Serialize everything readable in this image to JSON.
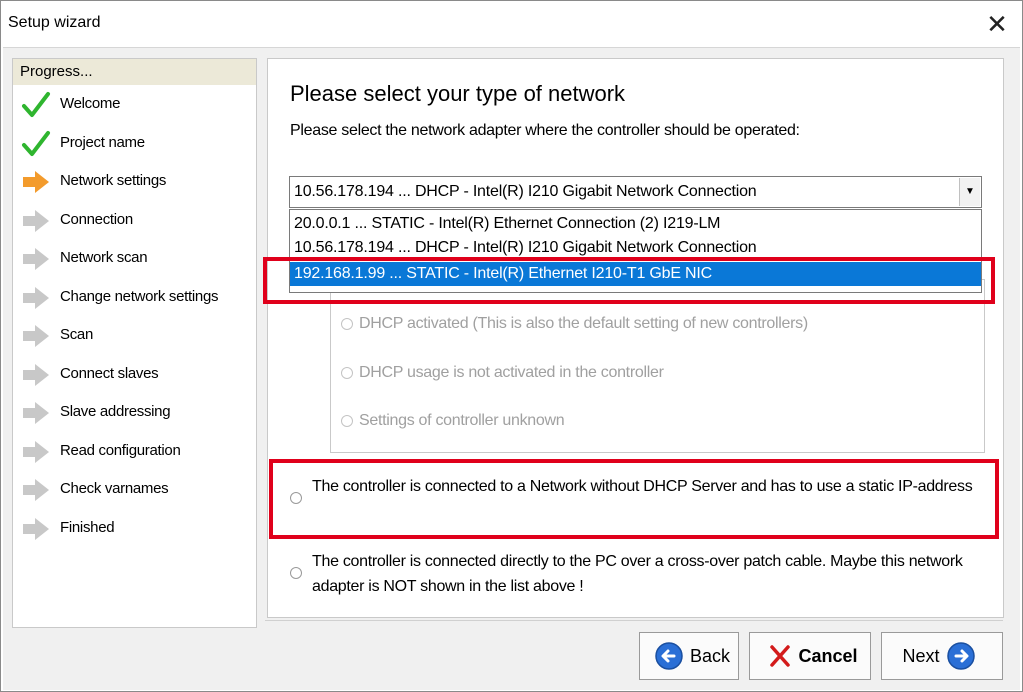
{
  "window": {
    "title": "Setup wizard",
    "close_glyph": "✕"
  },
  "sidebar": {
    "header": "Progress...",
    "steps": [
      {
        "label": "Welcome",
        "state": "done",
        "icon": "check-icon"
      },
      {
        "label": "Project name",
        "state": "done",
        "icon": "check-icon"
      },
      {
        "label": "Network settings",
        "state": "current",
        "icon": "arrow-right-icon"
      },
      {
        "label": "Connection",
        "state": "pending",
        "icon": "arrow-right-icon"
      },
      {
        "label": "Network scan",
        "state": "pending",
        "icon": "arrow-right-icon"
      },
      {
        "label": "Change network settings",
        "state": "pending",
        "icon": "arrow-right-icon"
      },
      {
        "label": "Scan",
        "state": "pending",
        "icon": "arrow-right-icon"
      },
      {
        "label": "Connect slaves",
        "state": "pending",
        "icon": "arrow-right-icon"
      },
      {
        "label": "Slave addressing",
        "state": "pending",
        "icon": "arrow-right-icon"
      },
      {
        "label": "Read configuration",
        "state": "pending",
        "icon": "arrow-right-icon"
      },
      {
        "label": "Check varnames",
        "state": "pending",
        "icon": "arrow-right-icon"
      },
      {
        "label": "Finished",
        "state": "pending",
        "icon": "arrow-right-icon"
      }
    ]
  },
  "main": {
    "heading": "Please select your type of network",
    "subtitle": "Please select the network adapter where the controller should be operated:",
    "adapter_select": {
      "value": "10.56.178.194  ...  DHCP - Intel(R) I210 Gigabit Network Connection",
      "options": [
        "20.0.0.1  ...  STATIC - Intel(R) Ethernet Connection (2) I219-LM",
        "10.56.178.194  ...  DHCP - Intel(R) I210 Gigabit Network Connection",
        "192.168.1.99  ...  STATIC - Intel(R) Ethernet I210-T1 GbE NIC"
      ],
      "highlighted_index": 2
    },
    "dhcp_group": {
      "options": [
        "DHCP activated (This is also the default setting of new controllers)",
        "DHCP usage is not activated in the controller",
        "Settings of controller unknown"
      ],
      "disabled": true
    },
    "static_option": "The controller is connected to a Network without DHCP Server and has to use a static IP-address",
    "crossover_option": "The controller is connected directly to the PC over a cross-over patch cable. Maybe this network adapter is NOT shown in the list above !"
  },
  "buttons": {
    "back": "Back",
    "cancel": "Cancel",
    "next": "Next"
  },
  "colors": {
    "highlight_box": "#e0001b",
    "selection": "#0a78d7",
    "check": "#2fb52f",
    "arrow_active": "#f39b2c",
    "arrow_inactive": "#c8c8c8"
  }
}
